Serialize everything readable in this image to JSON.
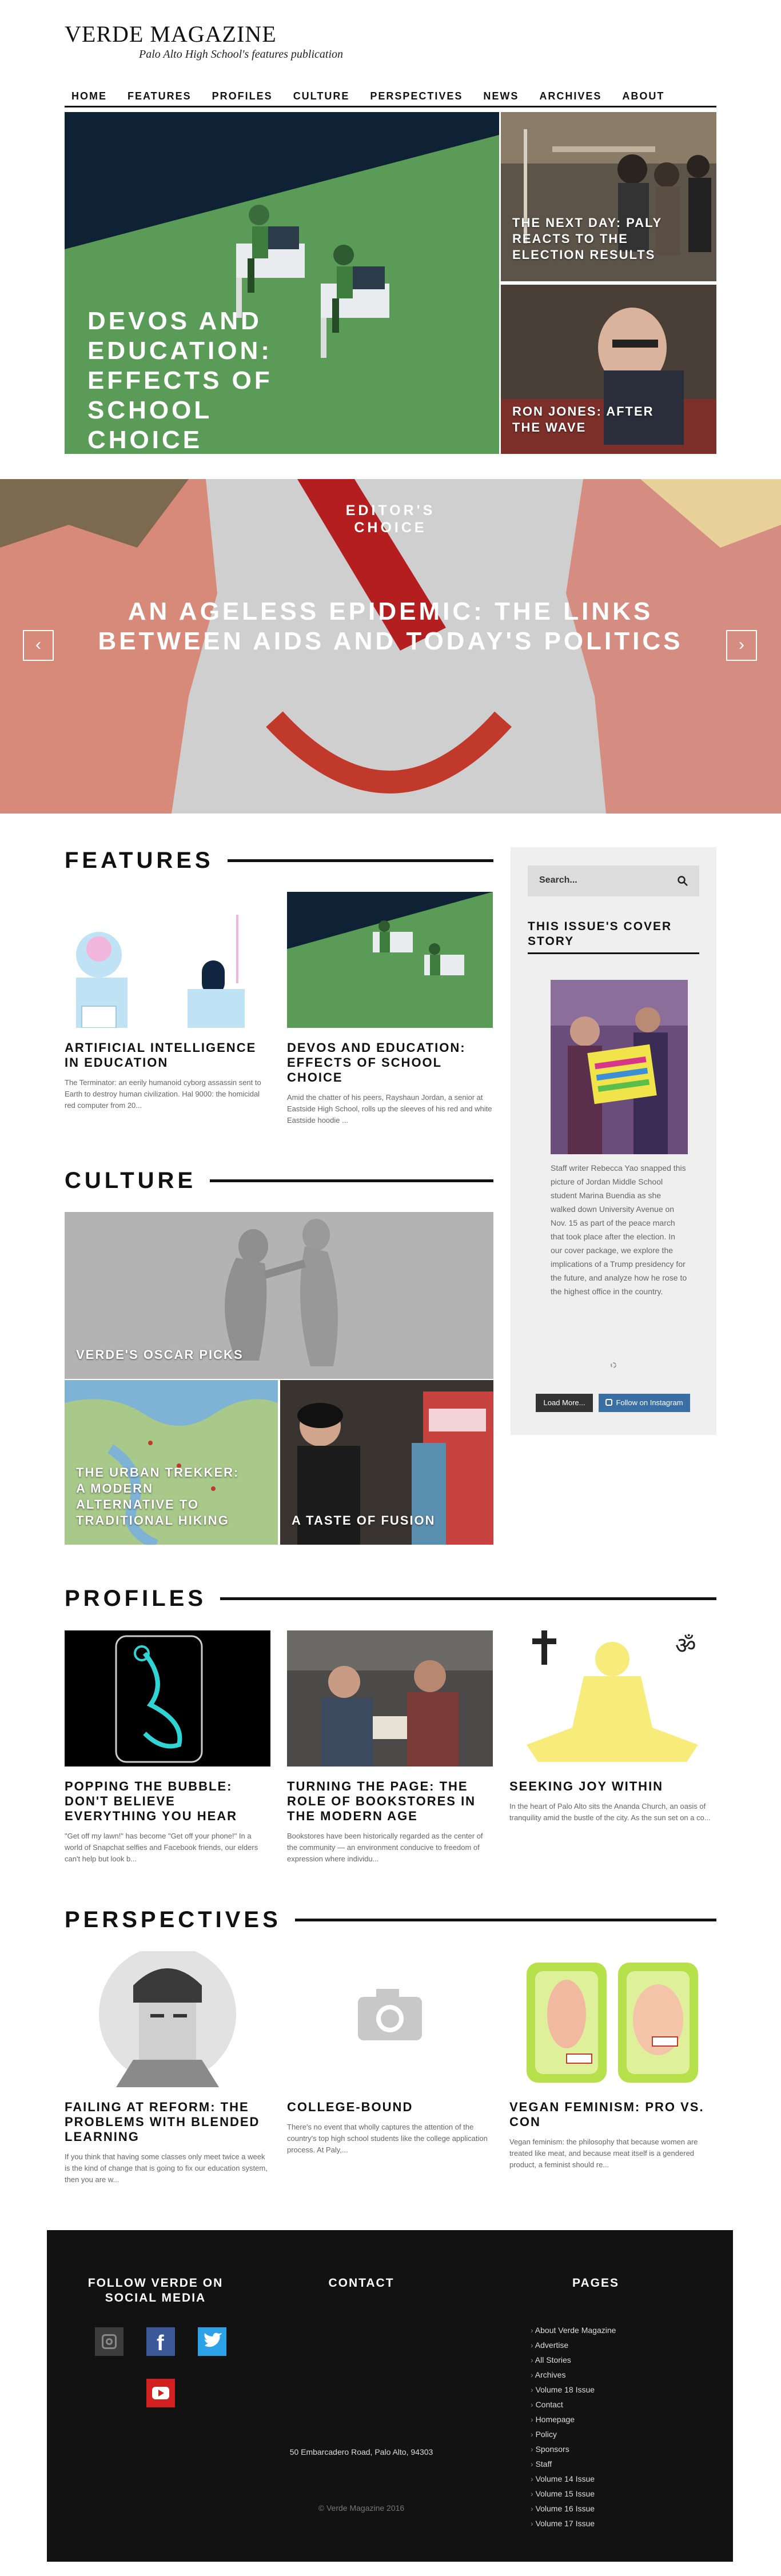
{
  "site": {
    "title": "VERDE MAGAZINE",
    "tagline": "Palo Alto High School's features publication"
  },
  "nav": [
    "HOME",
    "FEATURES",
    "PROFILES",
    "CULTURE",
    "PERSPECTIVES",
    "NEWS",
    "ARCHIVES",
    "ABOUT"
  ],
  "hero": {
    "main_title": "DEVOS AND EDUCATION: EFFECTS OF SCHOOL CHOICE",
    "side": [
      {
        "title": "THE NEXT DAY: PALY REACTS TO THE ELECTION RESULTS"
      },
      {
        "title": "RON JONES: AFTER THE WAVE"
      }
    ]
  },
  "editors_choice": {
    "label": "EDITOR'S CHOICE",
    "title": "AN AGELESS EPIDEMIC: THE LINKS BETWEEN AIDS AND TODAY'S POLITICS",
    "prev_icon": "‹",
    "next_icon": "›"
  },
  "features": {
    "heading": "FEATURES",
    "items": [
      {
        "title": "ARTIFICIAL INTELLIGENCE IN EDUCATION",
        "excerpt": "The Terminator: an eerily humanoid cyborg assassin sent to Earth to destroy human civilization. Hal 9000: the homicidal red computer from 20..."
      },
      {
        "title": "DEVOS AND EDUCATION: EFFECTS OF SCHOOL CHOICE",
        "excerpt": "Amid the chatter of his peers, Rayshaun Jordan, a senior at Eastside High School, rolls up the sleeves of his red and white Eastside hoodie ..."
      }
    ]
  },
  "sidebar": {
    "search_placeholder": "Search...",
    "cover_heading": "THIS ISSUE'S COVER STORY",
    "cover_text": "Staff writer Rebecca Yao snapped this picture of Jordan Middle School student Marina Buendia as she walked down University Avenue on Nov. 15 as part of the peace march that took place after the election. In our cover package, we explore the implications of a Trump presidency for the future, and analyze how he rose to the highest office in the country.",
    "load_more": "Load More...",
    "follow_instagram": "Follow on Instagram"
  },
  "culture": {
    "heading": "CULTURE",
    "items": [
      {
        "title": "VERDE'S OSCAR PICKS"
      },
      {
        "title": "THE URBAN TREKKER: A MODERN ALTERNATIVE TO TRADITIONAL HIKING"
      },
      {
        "title": "A TASTE OF FUSION"
      }
    ]
  },
  "profiles": {
    "heading": "PROFILES",
    "items": [
      {
        "title": "POPPING THE BUBBLE: DON'T BELIEVE EVERYTHING YOU HEAR",
        "excerpt": "\"Get off my lawn!\" has become \"Get off your phone!\" In a world of Snapchat selfies and Facebook friends, our elders can't help but look b..."
      },
      {
        "title": "TURNING THE PAGE: THE ROLE OF BOOKSTORES IN THE MODERN AGE",
        "excerpt": "Bookstores have been historically regarded as the center of the community — an environment conducive to freedom of expression where individu..."
      },
      {
        "title": "SEEKING JOY WITHIN",
        "excerpt": "In the heart of Palo Alto sits the Ananda Church, an oasis of tranquility amid the bustle of the city. As the sun set on a co..."
      }
    ]
  },
  "perspectives": {
    "heading": "PERSPECTIVES",
    "items": [
      {
        "title": "FAILING AT REFORM: THE PROBLEMS WITH BLENDED LEARNING",
        "excerpt": "If you think that having some classes only meet twice a week is the kind of change that is going to fix our education system, then you are w..."
      },
      {
        "title": "COLLEGE-BOUND",
        "excerpt": "There's no event that wholly captures the attention of the country's top high school students like the college application process. At Paly,..."
      },
      {
        "title": "VEGAN FEMINISM: PRO VS. CON",
        "excerpt": "Vegan feminism: the philosophy that because women are treated like meat, and because meat itself is a gendered product, a feminist should re..."
      }
    ]
  },
  "footer": {
    "social_heading": "FOLLOW VERDE ON SOCIAL MEDIA",
    "contact_heading": "CONTACT",
    "pages_heading": "PAGES",
    "address": "50 Embarcadero Road, Palo Alto, 94303",
    "copyright": "© Verde Magazine 2016",
    "pages": [
      "About Verde Magazine",
      "Advertise",
      "All Stories",
      "Archives",
      "Volume 18 Issue",
      "Contact",
      "Homepage",
      "Policy",
      "Sponsors",
      "Staff",
      "Volume 14 Issue",
      "Volume 15 Issue",
      "Volume 16 Issue",
      "Volume 17 Issue"
    ],
    "colors": {
      "instagram": "#3c3c3c",
      "facebook": "#3b5998",
      "twitter": "#2ca3e8",
      "youtube": "#d21f1f"
    }
  }
}
